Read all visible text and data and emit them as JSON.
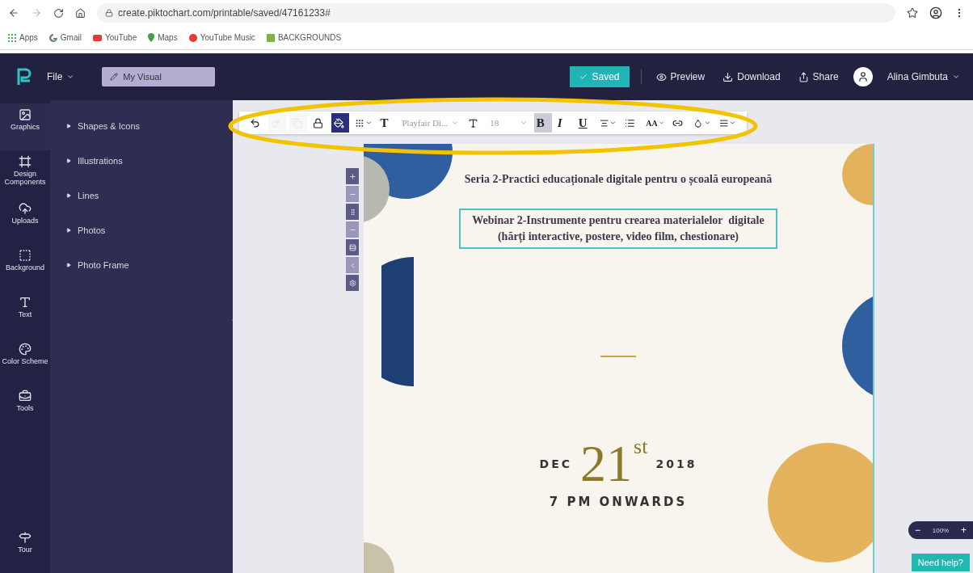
{
  "browser": {
    "url": "create.piktochart.com/printable/saved/47161233#",
    "bookmarks": [
      {
        "label": "Apps",
        "color": "#4caf50"
      },
      {
        "label": "Gmail",
        "color": "#607d8b"
      },
      {
        "label": "YouTube",
        "color": "#e53935"
      },
      {
        "label": "Maps",
        "color": "#43a047"
      },
      {
        "label": "YouTube Music",
        "color": "#e53935"
      },
      {
        "label": "BACKGROUNDS",
        "color": "#7cb342"
      }
    ]
  },
  "header": {
    "file_menu": "File",
    "title_field": "My Visual",
    "saved_button": "Saved",
    "actions": [
      "Preview",
      "Download",
      "Share"
    ],
    "user_name": "Alina Gimbuta"
  },
  "sidebar": {
    "tabs": [
      {
        "label": "Graphics",
        "selected": true
      },
      {
        "label": "Design Components",
        "selected": false
      },
      {
        "label": "Uploads",
        "selected": false
      },
      {
        "label": "Background",
        "selected": false
      },
      {
        "label": "Text",
        "selected": false
      },
      {
        "label": "Color Scheme",
        "selected": false
      },
      {
        "label": "Tools",
        "selected": false
      }
    ],
    "tour": "Tour",
    "items": [
      {
        "label": "Shapes & Icons",
        "expanded": false
      },
      {
        "label": "Illustrations",
        "expanded": false
      },
      {
        "label": "Lines",
        "expanded": false
      },
      {
        "label": "Photos",
        "expanded": false
      },
      {
        "label": "Photo Frame",
        "expanded": false
      }
    ]
  },
  "toolbar": [
    {
      "kind": "icon",
      "selected": false,
      "disabled": false,
      "caret": false
    },
    {
      "kind": "icon",
      "selected": false,
      "disabled": true,
      "caret": false
    },
    {
      "kind": "icon",
      "selected": false,
      "disabled": true,
      "caret": false
    },
    {
      "kind": "icon",
      "selected": false,
      "disabled": false,
      "caret": false
    },
    {
      "kind": "icon",
      "selected": true,
      "disabled": false,
      "caret": false
    },
    {
      "kind": "icon",
      "selected": false,
      "disabled": false,
      "caret": true
    },
    {
      "kind": "glyph",
      "label": "T",
      "selected": false,
      "disabled": false,
      "caret": false
    },
    {
      "kind": "select",
      "label": "Playfair Di...",
      "selected": false,
      "disabled": false,
      "caret": true
    },
    {
      "kind": "icon",
      "selected": false,
      "disabled": false,
      "caret": false
    },
    {
      "kind": "select",
      "label": "18",
      "selected": false,
      "disabled": false,
      "caret": true
    },
    {
      "kind": "glyph",
      "label": "B",
      "selected": true,
      "disabled": false,
      "caret": false
    },
    {
      "kind": "glyph",
      "label": "I",
      "selected": false,
      "disabled": false,
      "caret": false
    },
    {
      "kind": "glyph",
      "label": "U",
      "selected": false,
      "disabled": false,
      "caret": false
    },
    {
      "kind": "icon",
      "selected": false,
      "disabled": false,
      "caret": true
    },
    {
      "kind": "icon",
      "selected": false,
      "disabled": false,
      "caret": false
    },
    {
      "kind": "glyph",
      "label": "AA",
      "selected": false,
      "disabled": false,
      "caret": true
    },
    {
      "kind": "icon",
      "selected": false,
      "disabled": false,
      "caret": false
    },
    {
      "kind": "icon",
      "selected": false,
      "disabled": false,
      "caret": true
    },
    {
      "kind": "icon",
      "selected": false,
      "disabled": false,
      "caret": true
    }
  ],
  "mini_tools": [
    {
      "disabled": false
    },
    {
      "disabled": true
    },
    {
      "disabled": false
    },
    {
      "disabled": true
    },
    {
      "disabled": false
    },
    {
      "disabled": true
    },
    {
      "disabled": false
    }
  ],
  "poster": {
    "heading": "Seria 2-Practici educaționale digitale pentru o școală europeană",
    "selected_box": [
      "Webinar 2-Instrumente pentru crearea materialelor  digitale",
      "(hărți interactive, postere, video film, chestionare)"
    ],
    "month": "DEC",
    "day": "21",
    "day_suffix": "st",
    "year": "2018",
    "time": "7 PM ONWARDS"
  },
  "zoom": {
    "value": "100%",
    "minus": "−",
    "plus": "+"
  },
  "help_button": "Need help?"
}
